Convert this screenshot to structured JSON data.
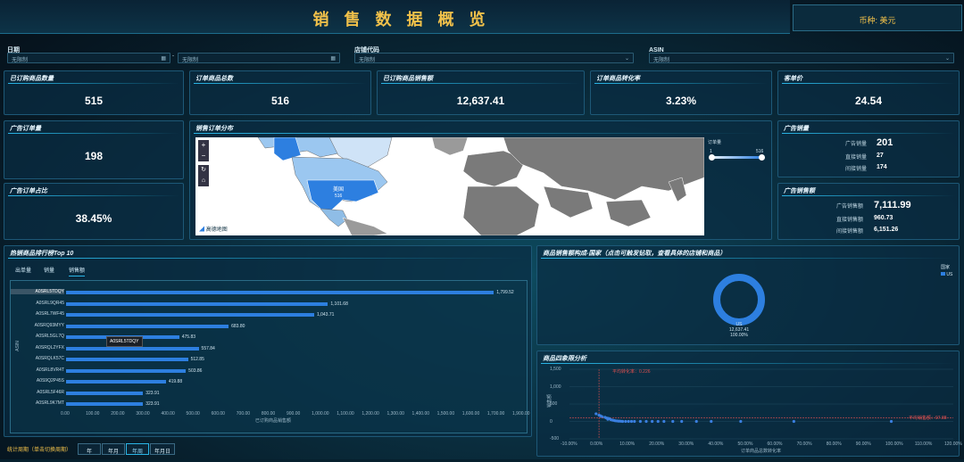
{
  "header": {
    "title": "销 售 数 据 概 览",
    "currency": "币种: 美元"
  },
  "filters": [
    {
      "label": "日期",
      "start_placeholder": "无限制",
      "end_placeholder": "无限制",
      "separator": "-"
    },
    {
      "label": "店铺代码",
      "placeholder": "无限制"
    },
    {
      "label": "ASIN",
      "placeholder": "无限制"
    }
  ],
  "kpis": [
    {
      "label": "已订购商品数量",
      "value": "515"
    },
    {
      "label": "订单商品总数",
      "value": "516"
    },
    {
      "label": "已订购商品销售额",
      "value": "12,637.41"
    },
    {
      "label": "订单商品转化率",
      "value": "3.23%"
    },
    {
      "label": "客单价",
      "value": "24.54"
    },
    {
      "label": "广告订单量",
      "value": "198"
    },
    {
      "label": "广告订单占比",
      "value": "38.45%"
    }
  ],
  "map": {
    "title": "销售订单分布",
    "legend_title": "订单量",
    "legend_min": "1",
    "legend_max": "516",
    "country_label": "美国",
    "country_value": "516",
    "credit": "高德地图",
    "zoom_in": "+",
    "zoom_out": "−"
  },
  "ad_sales": {
    "title": "广告销量",
    "rows": [
      {
        "label": "广告销量",
        "value": "201"
      },
      {
        "label": "直接销量",
        "value": "27"
      },
      {
        "label": "间接销量",
        "value": "174"
      }
    ]
  },
  "ad_revenue": {
    "title": "广告销售额",
    "rows": [
      {
        "label": "广告销售额",
        "value": "7,111.99"
      },
      {
        "label": "直接销售额",
        "value": "960.73"
      },
      {
        "label": "间接销售额",
        "value": "6,151.26"
      }
    ]
  },
  "top10": {
    "title": "热销商品排行榜Top 10",
    "tabs": [
      "出单量",
      "销量",
      "销售额"
    ],
    "active_tab": "销售额",
    "yaxis_label": "ASIN",
    "xaxis_label": "已订购商品销售额",
    "tooltip": "A0SRL5TDQY",
    "period_label": "统计周期（单击切换周期）",
    "periods": [
      "年",
      "年月",
      "年周",
      "年月日"
    ],
    "active_period": "年周"
  },
  "donut": {
    "title": "商品销售额构成-国家（点击可触发钻取，查看具体的店铺和商品）",
    "legend_title": "国家",
    "legend_item": "US",
    "center_country": "US",
    "center_value": "12,637.41",
    "center_pct": "100.00%",
    "color": "#2d7fe0"
  },
  "quadrant": {
    "title": "商品四象限分析",
    "yaxis_label": "销售额",
    "xaxis_label": "订单商品总数转化率",
    "avg_conv_label": "平均转化率：0.226",
    "avg_sales_label": "平均销售额：97.88",
    "yticks": [
      "1,500",
      "1,000",
      "500",
      "0",
      "-500"
    ],
    "xticks": [
      "-10.00%",
      "0.00%",
      "10.00%",
      "20.00%",
      "30.00%",
      "40.00%",
      "50.00%",
      "60.00%",
      "70.00%",
      "80.00%",
      "90.00%",
      "100.00%",
      "110.00%",
      "120.00%"
    ]
  },
  "chart_data": [
    {
      "type": "bar",
      "title": "热销商品排行榜Top 10",
      "xlabel": "已订购商品销售额",
      "ylabel": "ASIN",
      "categories": [
        "A0SRL5TDQY",
        "A0SRL9QR45",
        "A0SRL7WF45",
        "A0SRQ93MYY",
        "A0SRL5GL7Q",
        "A0SRQL2YFX",
        "A0SRQLK57C",
        "A0SRL8VR4T",
        "A0S9Q2P45S",
        "A0SRL5F46R",
        "A0SRL9K7MT"
      ],
      "values": [
        1799.52,
        1101.68,
        1043.71,
        683.8,
        475.83,
        557.84,
        512.85,
        503.86,
        419.88,
        323.91,
        323.91
      ],
      "value_labels": [
        "1,799.52",
        "1,101.68",
        "1,043.71",
        "683.80",
        "475.83",
        "557.84",
        "512.85",
        "503.86",
        "419.88",
        "323.91",
        "323.91"
      ],
      "xticks": [
        "0.00",
        "100.00",
        "200.00",
        "300.00",
        "400.00",
        "500.00",
        "600.00",
        "700.00",
        "800.00",
        "900.00",
        "1,000.00",
        "1,100.00",
        "1,200.00",
        "1,300.00",
        "1,400.00",
        "1,500.00",
        "1,600.00",
        "1,700.00",
        "1,900.00"
      ],
      "xlim": [
        0,
        1900
      ]
    },
    {
      "type": "pie",
      "title": "商品销售额构成-国家",
      "categories": [
        "US"
      ],
      "values": [
        12637.41
      ]
    },
    {
      "type": "scatter",
      "title": "商品四象限分析",
      "xlabel": "订单商品总数转化率",
      "ylabel": "销售额",
      "xlim": [
        -0.1,
        1.2
      ],
      "ylim": [
        -500,
        1500
      ],
      "points": [
        [
          -0.01,
          220
        ],
        [
          0.0,
          180
        ],
        [
          0.005,
          160
        ],
        [
          0.01,
          140
        ],
        [
          0.02,
          120
        ],
        [
          0.025,
          100
        ],
        [
          0.03,
          90
        ],
        [
          0.03,
          60
        ],
        [
          0.035,
          80
        ],
        [
          0.04,
          50
        ],
        [
          0.045,
          40
        ],
        [
          0.05,
          30
        ],
        [
          0.055,
          20
        ],
        [
          0.06,
          15
        ],
        [
          0.065,
          10
        ],
        [
          0.07,
          8
        ],
        [
          0.075,
          5
        ],
        [
          0.08,
          0
        ],
        [
          0.09,
          0
        ],
        [
          0.1,
          0
        ],
        [
          0.11,
          0
        ],
        [
          0.12,
          0
        ],
        [
          0.14,
          0
        ],
        [
          0.16,
          0
        ],
        [
          0.18,
          0
        ],
        [
          0.2,
          0
        ],
        [
          0.22,
          0
        ],
        [
          0.25,
          0
        ],
        [
          0.28,
          0
        ],
        [
          0.33,
          0
        ],
        [
          0.38,
          0
        ],
        [
          0.48,
          0
        ],
        [
          0.66,
          0
        ],
        [
          0.99,
          0
        ]
      ]
    }
  ]
}
